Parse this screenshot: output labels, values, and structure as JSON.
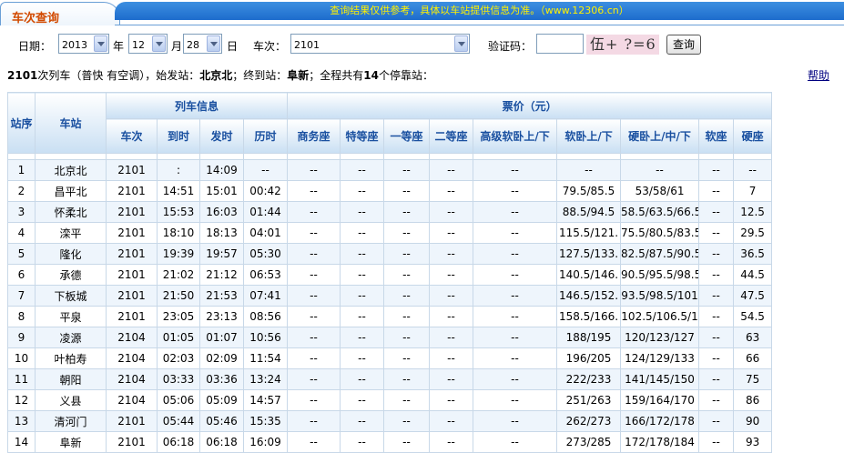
{
  "header": {
    "tab_title": "车次查询",
    "notice": "查询结果仅供参考，具体以车站提供信息为准。（www.12306.cn）"
  },
  "form": {
    "date_label": "日期：",
    "year": "2013",
    "year_unit": "年",
    "month": "12",
    "month_unit": "月",
    "day": "28",
    "day_unit": "日",
    "train_label": "车次：",
    "train_value": "2101",
    "captcha_label": "验证码：",
    "captcha_input": "",
    "captcha_text": "伍+ ?=6",
    "query_button": "查询"
  },
  "summary": {
    "train": "2101",
    "desc": "次列车（普快 有空调），始发站：",
    "origin": "北京北",
    "mid": "；终到站：",
    "terminal": "阜新",
    "tail1": "；全程共有",
    "stops": "14",
    "tail2": "个停靠站："
  },
  "help_link": "帮助",
  "table": {
    "group_headers": {
      "seq": "站序",
      "station": "车站",
      "train_info": "列车信息",
      "price": "票价（元）"
    },
    "sub_headers": [
      "车次",
      "到时",
      "发时",
      "历时",
      "商务座",
      "特等座",
      "一等座",
      "二等座",
      "高级软卧上/下",
      "软卧上/下",
      "硬卧上/中/下",
      "软座",
      "硬座"
    ],
    "rows": [
      [
        "1",
        "北京北",
        "2101",
        ":",
        "14:09",
        "--",
        "--",
        "--",
        "--",
        "--",
        "--",
        "--",
        "--",
        "--",
        "--"
      ],
      [
        "2",
        "昌平北",
        "2101",
        "14:51",
        "15:01",
        "00:42",
        "--",
        "--",
        "--",
        "--",
        "--",
        "79.5/85.5",
        "53/58/61",
        "--",
        "7"
      ],
      [
        "3",
        "怀柔北",
        "2101",
        "15:53",
        "16:03",
        "01:44",
        "--",
        "--",
        "--",
        "--",
        "--",
        "88.5/94.5",
        "58.5/63.5/66.5",
        "--",
        "12.5"
      ],
      [
        "4",
        "滦平",
        "2101",
        "18:10",
        "18:13",
        "04:01",
        "--",
        "--",
        "--",
        "--",
        "--",
        "115.5/121.",
        "75.5/80.5/83.5",
        "--",
        "29.5"
      ],
      [
        "5",
        "隆化",
        "2101",
        "19:39",
        "19:57",
        "05:30",
        "--",
        "--",
        "--",
        "--",
        "--",
        "127.5/133.",
        "82.5/87.5/90.5",
        "--",
        "36.5"
      ],
      [
        "6",
        "承德",
        "2101",
        "21:02",
        "21:12",
        "06:53",
        "--",
        "--",
        "--",
        "--",
        "--",
        "140.5/146.",
        "90.5/95.5/98.5",
        "--",
        "44.5"
      ],
      [
        "7",
        "下板城",
        "2101",
        "21:50",
        "21:53",
        "07:41",
        "--",
        "--",
        "--",
        "--",
        "--",
        "146.5/152.",
        "93.5/98.5/101",
        "--",
        "47.5"
      ],
      [
        "8",
        "平泉",
        "2101",
        "23:05",
        "23:13",
        "08:56",
        "--",
        "--",
        "--",
        "--",
        "--",
        "158.5/166.",
        "102.5/106.5/1",
        "--",
        "54.5"
      ],
      [
        "9",
        "凌源",
        "2104",
        "01:05",
        "01:07",
        "10:56",
        "--",
        "--",
        "--",
        "--",
        "--",
        "188/195",
        "120/123/127",
        "--",
        "63"
      ],
      [
        "10",
        "叶柏寿",
        "2104",
        "02:03",
        "02:09",
        "11:54",
        "--",
        "--",
        "--",
        "--",
        "--",
        "196/205",
        "124/129/133",
        "--",
        "66"
      ],
      [
        "11",
        "朝阳",
        "2104",
        "03:33",
        "03:36",
        "13:24",
        "--",
        "--",
        "--",
        "--",
        "--",
        "222/233",
        "141/145/150",
        "--",
        "75"
      ],
      [
        "12",
        "义县",
        "2104",
        "05:06",
        "05:09",
        "14:57",
        "--",
        "--",
        "--",
        "--",
        "--",
        "251/263",
        "159/164/170",
        "--",
        "86"
      ],
      [
        "13",
        "清河门",
        "2101",
        "05:44",
        "05:46",
        "15:35",
        "--",
        "--",
        "--",
        "--",
        "--",
        "262/273",
        "166/172/178",
        "--",
        "90"
      ],
      [
        "14",
        "阜新",
        "2101",
        "06:18",
        "06:18",
        "16:09",
        "--",
        "--",
        "--",
        "--",
        "--",
        "273/285",
        "172/178/184",
        "--",
        "93"
      ]
    ]
  }
}
